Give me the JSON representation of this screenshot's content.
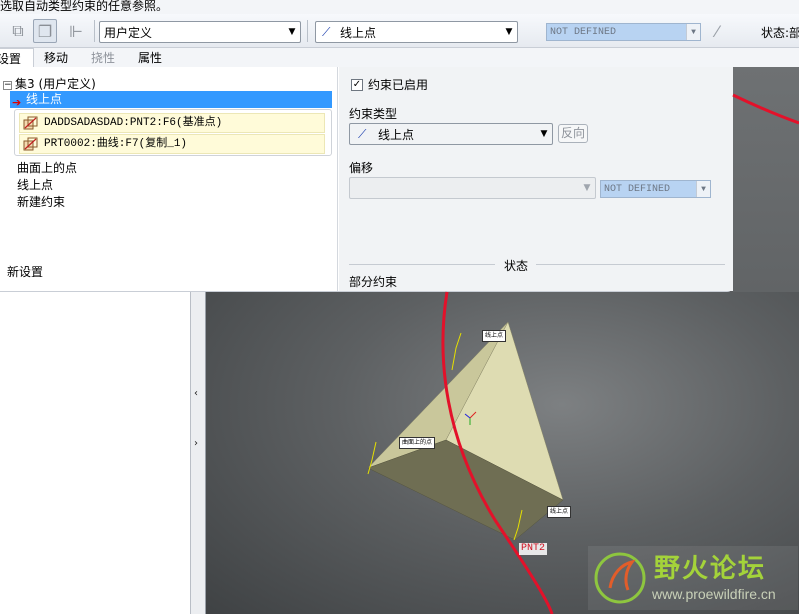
{
  "status_line": "选取自动类型约束的任意参照。",
  "toolbar": {
    "set_type": "用户定义",
    "constraint_type": "线上点",
    "offset_value": "NOT DEFINED",
    "status_label": "状态:部"
  },
  "tabs": [
    {
      "label": "设置"
    },
    {
      "label": "移动"
    },
    {
      "label": "挠性"
    },
    {
      "label": "属性"
    }
  ],
  "set_tree": {
    "root": "集3 (用户定义)",
    "selected_constraint": "线上点",
    "references": [
      "DADDSADASDAD:PNT2:F6(基准点)",
      "PRT0002:曲线:F7(复制_1)"
    ],
    "constraints": [
      "曲面上的点",
      "线上点"
    ],
    "new_constraint": "新建约束",
    "new_set": "新设置"
  },
  "constraint_panel": {
    "enabled_label": "约束已启用",
    "enabled": true,
    "type_label": "约束类型",
    "type_value": "线上点",
    "flip_label": "反向",
    "offset_label": "偏移",
    "offset_value": "NOT DEFINED",
    "status_title": "状态",
    "status_value": "部分约束"
  },
  "viewport": {
    "annotations": [
      "线上点",
      "曲面上的点",
      "线上点"
    ],
    "point_label": "PNT2",
    "curve_color": "#e3112a"
  },
  "watermark": {
    "title": "野火论坛",
    "url": "www.proewildfire.cn"
  },
  "colors": {
    "selection": "#3399ff",
    "reference_bg": "#fffbd9",
    "model_face": "#d8d7ac"
  }
}
